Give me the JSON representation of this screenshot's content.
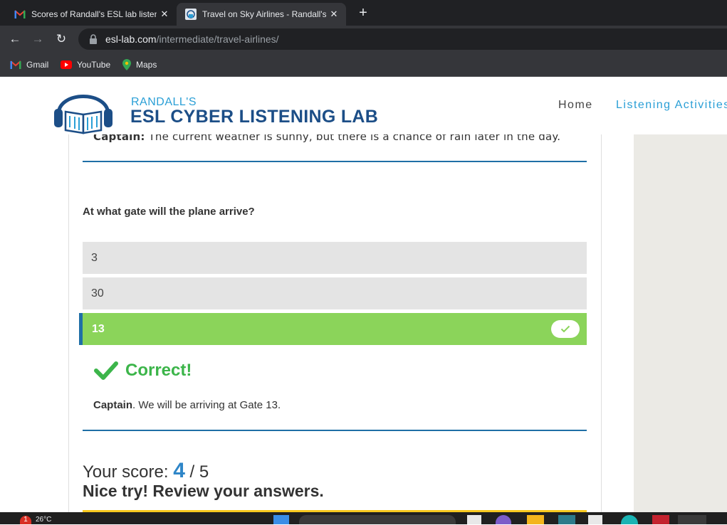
{
  "browser": {
    "tabs": [
      {
        "title": "Scores of Randall's ESL lab listen",
        "favicon": "gmail-icon",
        "active": false
      },
      {
        "title": "Travel on Sky Airlines - Randall's",
        "favicon": "esl-lab-icon",
        "active": true
      }
    ],
    "new_tab_label": "+",
    "url_host": "esl-lab.com",
    "url_path": "/intermediate/travel-airlines/",
    "bookmarks": [
      {
        "label": "Gmail",
        "icon": "gmail-icon"
      },
      {
        "label": "YouTube",
        "icon": "youtube-icon"
      },
      {
        "label": "Maps",
        "icon": "maps-icon"
      }
    ]
  },
  "site": {
    "brand_top": "RANDALL'S",
    "brand_main": "ESL CYBER LISTENING LAB",
    "nav": {
      "home": "Home",
      "listening": "Listening Activities"
    }
  },
  "quiz": {
    "previous_speaker": "Captain:",
    "previous_line": "The current weather is sunny, but there is a chance of rain later in the day.",
    "question": "At what gate will the plane arrive?",
    "options": [
      "3",
      "30",
      "13"
    ],
    "selected_index": 2,
    "result_label": "Correct!",
    "explanation_speaker": "Captain",
    "explanation_text": ". We will be arriving at Gate 13.",
    "score_label": "Your score:",
    "score_value": "4",
    "score_total": "/ 5",
    "feedback": "Nice try! Review your answers."
  },
  "taskbar": {
    "weather_badge": "1",
    "temperature": "26°C"
  },
  "colors": {
    "correct_green": "#8bd45a",
    "correct_text": "#3cb54a",
    "accent_blue": "#2a9fd6",
    "divider_blue": "#1f6fa6"
  }
}
